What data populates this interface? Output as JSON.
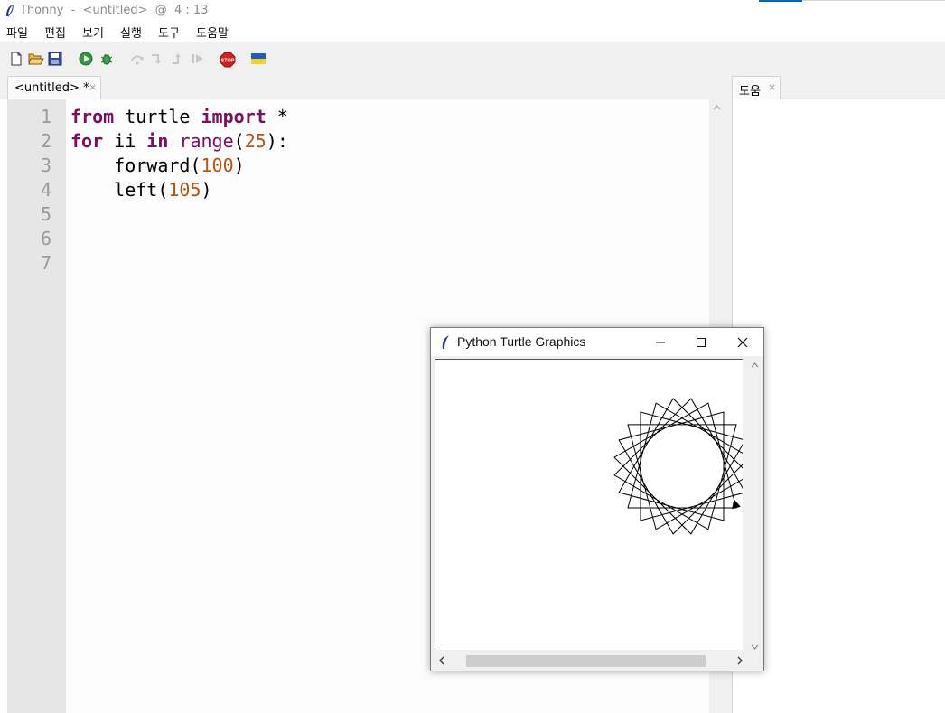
{
  "window": {
    "title": "Thonny  -  <untitled>  @  4 : 13"
  },
  "menu": [
    "파일",
    "편집",
    "보기",
    "실행",
    "도구",
    "도움말"
  ],
  "toolbar": {
    "icons": [
      "new-file-icon",
      "open-file-icon",
      "save-icon",
      "run-icon",
      "debug-icon",
      "step-over-icon",
      "step-into-icon",
      "step-out-icon",
      "resume-icon",
      "stop-icon",
      "ukraine-flag-icon"
    ],
    "stop_label": "STOP"
  },
  "editor": {
    "tab_label": "<untitled>  *",
    "tab_close": "×",
    "line_numbers": [
      "1",
      "2",
      "3",
      "4",
      "5",
      "6",
      "7"
    ],
    "code": {
      "l1_kw1": "from",
      "l1_mod": " turtle ",
      "l1_kw2": "import",
      "l1_rest": " *",
      "l2_kw1": "for",
      "l2_var": " ii ",
      "l2_kw2": "in",
      "l2_fn": "range",
      "l2_open": "(",
      "l2_num": "25",
      "l2_close": "):",
      "l3_fn": "    forward(",
      "l3_num": "100",
      "l3_close": ")",
      "l4_fn": "    left(",
      "l4_num": "105",
      "l4_close": ")"
    }
  },
  "help_panel": {
    "tab_label": "도움",
    "tab_close": "×"
  },
  "turtle_window": {
    "title": "Python Turtle Graphics",
    "drawing": {
      "steps": 25,
      "forward": 100,
      "left_turn_degrees": 105
    }
  },
  "colors": {
    "keyword": "#7d0f5e",
    "number": "#b8540f",
    "gutter": "#e6e6e6",
    "toolbar_bg": "#f0f0f0"
  }
}
